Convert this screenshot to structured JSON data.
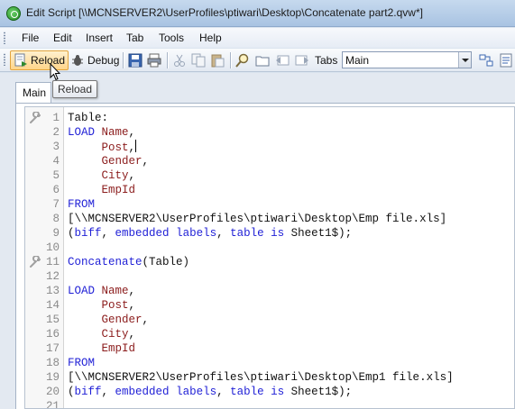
{
  "window": {
    "title": "Edit Script [\\\\MCNSERVER2\\UserProfiles\\ptiwari\\Desktop\\Concatenate part2.qvw*]"
  },
  "menu": [
    "File",
    "Edit",
    "Insert",
    "Tab",
    "Tools",
    "Help"
  ],
  "toolbar": {
    "reload_label": "Reload",
    "debug_label": "Debug",
    "tabs_label": "Tabs",
    "tabs_selected": "Main",
    "tooltip": "Reload"
  },
  "tab": {
    "label": "Main"
  },
  "editor": {
    "lines": [
      {
        "n": "1",
        "tokens": [
          {
            "t": "Table:",
            "c": "txt"
          }
        ]
      },
      {
        "n": "2",
        "tokens": [
          {
            "t": "LOAD",
            "c": "kw"
          },
          {
            "t": " ",
            "c": "txt"
          },
          {
            "t": "Name",
            "c": "fld"
          },
          {
            "t": ",",
            "c": "txt"
          }
        ]
      },
      {
        "n": "3",
        "tokens": [
          {
            "t": "     ",
            "c": "txt"
          },
          {
            "t": "Post",
            "c": "fld"
          },
          {
            "t": ",",
            "c": "txt"
          }
        ],
        "caret": true
      },
      {
        "n": "4",
        "tokens": [
          {
            "t": "     ",
            "c": "txt"
          },
          {
            "t": "Gender",
            "c": "fld"
          },
          {
            "t": ",",
            "c": "txt"
          }
        ]
      },
      {
        "n": "5",
        "tokens": [
          {
            "t": "     ",
            "c": "txt"
          },
          {
            "t": "City",
            "c": "fld"
          },
          {
            "t": ",",
            "c": "txt"
          }
        ]
      },
      {
        "n": "6",
        "tokens": [
          {
            "t": "     ",
            "c": "txt"
          },
          {
            "t": "EmpId",
            "c": "fld"
          }
        ]
      },
      {
        "n": "7",
        "tokens": [
          {
            "t": "FROM",
            "c": "kw"
          }
        ]
      },
      {
        "n": "8",
        "tokens": [
          {
            "t": "[\\\\MCNSERVER2\\UserProfiles\\ptiwari\\Desktop\\Emp file.xls]",
            "c": "txt"
          }
        ]
      },
      {
        "n": "9",
        "tokens": [
          {
            "t": "(",
            "c": "txt"
          },
          {
            "t": "biff",
            "c": "kw"
          },
          {
            "t": ", ",
            "c": "txt"
          },
          {
            "t": "embedded",
            "c": "kw"
          },
          {
            "t": " ",
            "c": "txt"
          },
          {
            "t": "labels",
            "c": "kw"
          },
          {
            "t": ", ",
            "c": "txt"
          },
          {
            "t": "table",
            "c": "kw"
          },
          {
            "t": " ",
            "c": "txt"
          },
          {
            "t": "is",
            "c": "kw"
          },
          {
            "t": " Sheet1$);",
            "c": "txt"
          }
        ]
      },
      {
        "n": "10",
        "tokens": []
      },
      {
        "n": "11",
        "tokens": [
          {
            "t": "Concatenate",
            "c": "kw"
          },
          {
            "t": "(Table)",
            "c": "txt"
          }
        ]
      },
      {
        "n": "12",
        "tokens": []
      },
      {
        "n": "13",
        "tokens": [
          {
            "t": "LOAD",
            "c": "kw"
          },
          {
            "t": " ",
            "c": "txt"
          },
          {
            "t": "Name",
            "c": "fld"
          },
          {
            "t": ",",
            "c": "txt"
          }
        ]
      },
      {
        "n": "14",
        "tokens": [
          {
            "t": "     ",
            "c": "txt"
          },
          {
            "t": "Post",
            "c": "fld"
          },
          {
            "t": ",",
            "c": "txt"
          }
        ]
      },
      {
        "n": "15",
        "tokens": [
          {
            "t": "     ",
            "c": "txt"
          },
          {
            "t": "Gender",
            "c": "fld"
          },
          {
            "t": ",",
            "c": "txt"
          }
        ]
      },
      {
        "n": "16",
        "tokens": [
          {
            "t": "     ",
            "c": "txt"
          },
          {
            "t": "City",
            "c": "fld"
          },
          {
            "t": ",",
            "c": "txt"
          }
        ]
      },
      {
        "n": "17",
        "tokens": [
          {
            "t": "     ",
            "c": "txt"
          },
          {
            "t": "EmpId",
            "c": "fld"
          }
        ]
      },
      {
        "n": "18",
        "tokens": [
          {
            "t": "FROM",
            "c": "kw"
          }
        ]
      },
      {
        "n": "19",
        "tokens": [
          {
            "t": "[\\\\MCNSERVER2\\UserProfiles\\ptiwari\\Desktop\\Emp1 file.xls]",
            "c": "txt"
          }
        ]
      },
      {
        "n": "20",
        "tokens": [
          {
            "t": "(",
            "c": "txt"
          },
          {
            "t": "biff",
            "c": "kw"
          },
          {
            "t": ", ",
            "c": "txt"
          },
          {
            "t": "embedded",
            "c": "kw"
          },
          {
            "t": " ",
            "c": "txt"
          },
          {
            "t": "labels",
            "c": "kw"
          },
          {
            "t": ", ",
            "c": "txt"
          },
          {
            "t": "table",
            "c": "kw"
          },
          {
            "t": " ",
            "c": "txt"
          },
          {
            "t": "is",
            "c": "kw"
          },
          {
            "t": " Sheet1$);",
            "c": "txt"
          }
        ]
      },
      {
        "n": "21",
        "tokens": []
      }
    ],
    "colors": {
      "keyword": "#1f1fd6",
      "field": "#8b1c1c",
      "text": "#111111"
    },
    "section_markers": [
      "wrench-icon",
      "wrench-icon"
    ]
  }
}
